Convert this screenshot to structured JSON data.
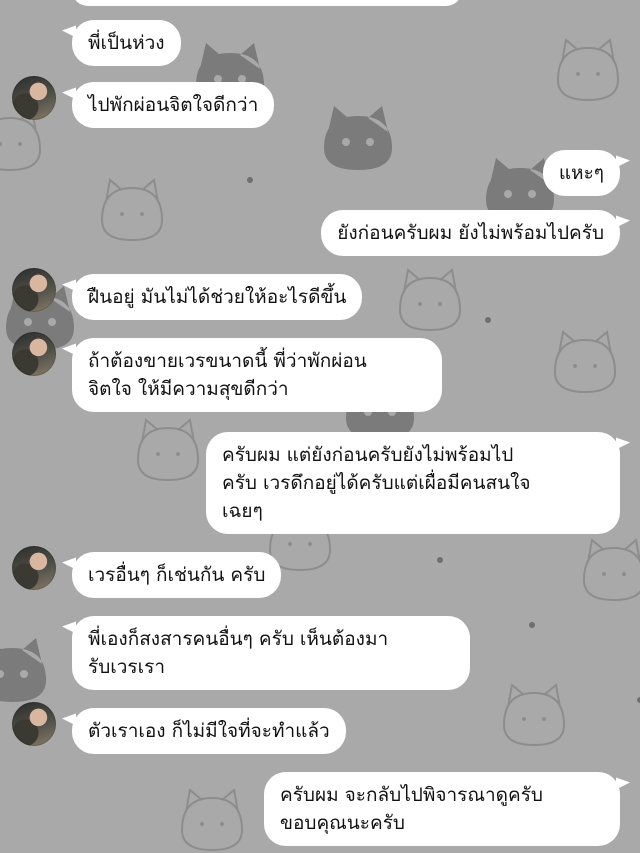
{
  "chat": {
    "messages": [
      {
        "side": "in",
        "avatar": false,
        "text": "พี่เป็นห่วง"
      },
      {
        "side": "in",
        "avatar": true,
        "text": "ไปพักผ่อนจิตใจดีกว่า"
      },
      {
        "side": "out",
        "text": "แหะๆ"
      },
      {
        "side": "out",
        "text": "ยังก่อนครับผม ยังไม่พร้อมไปครับ"
      },
      {
        "side": "in",
        "avatar": true,
        "text": "ฝืนอยู่ มันไม่ได้ช่วยให้อะไรดีขึ้น"
      },
      {
        "side": "in",
        "avatar": true,
        "text": "ถ้าต้องขายเวรขนาดนี้ พี่ว่าพักผ่อน\nจิตใจ ให้มีความสุขดีกว่า"
      },
      {
        "side": "out",
        "text": "ครับผม แต่ยังก่อนครับยังไม่พร้อมไป\nครับ เวรดึกอยู่ได้ครับแต่เผื่อมีคนสนใจ\nเฉยๆ"
      },
      {
        "side": "in",
        "avatar": true,
        "text": "เวรอื่นๆ ก็เช่นกัน ครับ"
      },
      {
        "side": "in",
        "avatar": false,
        "text": "พี่เองก็สงสารคนอื่นๆ ครับ เห็นต้องมา\nรับเวรเรา"
      },
      {
        "side": "in",
        "avatar": true,
        "text": "ตัวเราเอง ก็ไม่มีใจที่จะทำแล้ว"
      },
      {
        "side": "out",
        "text": "ครับผม จะกลับไปพิจารณาดูครับ\nขอบคุณนะครับ"
      }
    ]
  },
  "colors": {
    "background": "#a9a9a9",
    "bubble": "#ffffff",
    "text": "#111111"
  },
  "wallpaper_icon": "cat-face-icon"
}
